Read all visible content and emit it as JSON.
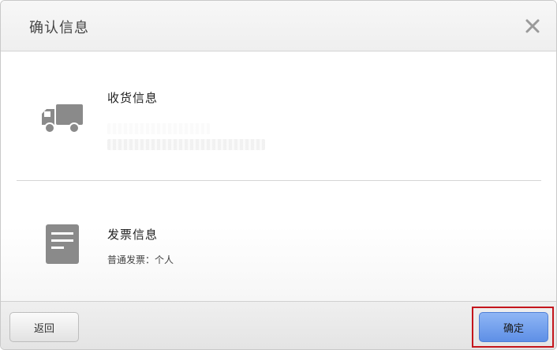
{
  "dialog": {
    "title": "确认信息"
  },
  "shipping": {
    "title": "收货信息",
    "icon": "truck-icon"
  },
  "invoice": {
    "title": "发票信息",
    "detail": "普通发票：个人",
    "icon": "document-icon"
  },
  "footer": {
    "back_label": "返回",
    "confirm_label": "确定"
  },
  "colors": {
    "icon_gray": "#8a8a8a",
    "confirm_blue": "#5e8fe6",
    "highlight_red": "#c4161c"
  }
}
